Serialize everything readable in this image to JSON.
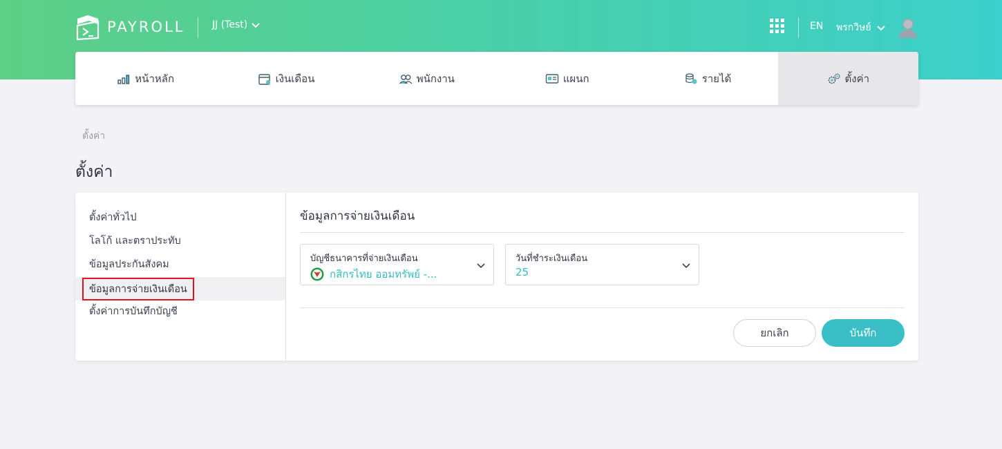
{
  "app": {
    "logo_text": "PAYROLL"
  },
  "header": {
    "company": "JJ (Test)",
    "language": "EN",
    "user_name": "พรกวิษย์"
  },
  "nav": {
    "items": [
      {
        "label": "หน้าหลัก",
        "icon": "dashboard-chart-icon"
      },
      {
        "label": "เงินเดือน",
        "icon": "calendar-icon"
      },
      {
        "label": "พนักงาน",
        "icon": "employees-icon"
      },
      {
        "label": "แผนก",
        "icon": "id-card-icon"
      },
      {
        "label": "รายได้",
        "icon": "coins-icon"
      },
      {
        "label": "ตั้งค่า",
        "icon": "gears-icon",
        "active": true
      }
    ]
  },
  "breadcrumb": "ตั้งค่า",
  "page_title": "ตั้งค่า",
  "sidebar": {
    "items": [
      {
        "label": "ตั้งค่าทั่วไป"
      },
      {
        "label": "โลโก้ และตราประทับ"
      },
      {
        "label": "ข้อมูลประกันสังคม"
      },
      {
        "label": "ข้อมูลการจ่ายเงินเดือน",
        "active": true
      },
      {
        "label": "ตั้งค่าการบันทึกบัญชี"
      }
    ]
  },
  "form": {
    "title": "ข้อมูลการจ่ายเงินเดือน",
    "bank_account": {
      "label": "บัญชีธนาคารที่จ่ายเงินเดือน",
      "value": "กสิกรไทย ออมทรัพย์ -..."
    },
    "pay_day": {
      "label": "วันที่ชำระเงินเดือน",
      "value": "25"
    },
    "cancel_label": "ยกเลิก",
    "save_label": "บันทึก"
  },
  "colors": {
    "header_gradient_start": "#5dcf86",
    "header_gradient_end": "#3ccfcb",
    "accent": "#3bbfc6",
    "highlight_border": "#e0141e"
  }
}
